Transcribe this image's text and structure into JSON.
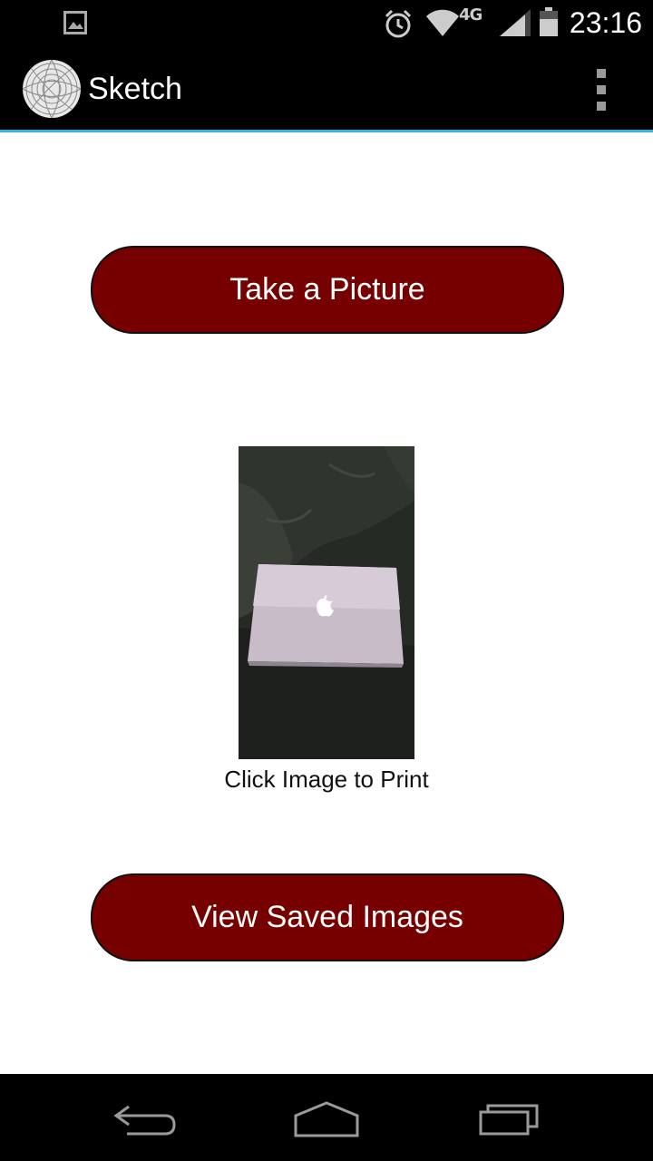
{
  "status_bar": {
    "time": "23:16",
    "network": "4G",
    "icons": [
      "gallery-icon",
      "alarm-icon",
      "wifi-icon",
      "signal-icon",
      "battery-icon"
    ]
  },
  "action_bar": {
    "title": "Sketch",
    "logo": "spiral-logo-icon",
    "menu_icon": "overflow-menu-icon",
    "divider_color": "#33b5e5"
  },
  "main": {
    "take_picture_label": "Take a Picture",
    "photo_alt": "Photo of a laptop on a dark couch",
    "print_caption": "Click Image to Print",
    "view_saved_label": "View Saved Images",
    "button_color": "#760000"
  },
  "nav_bar": {
    "icons": [
      "back-icon",
      "home-icon",
      "recents-icon"
    ]
  }
}
